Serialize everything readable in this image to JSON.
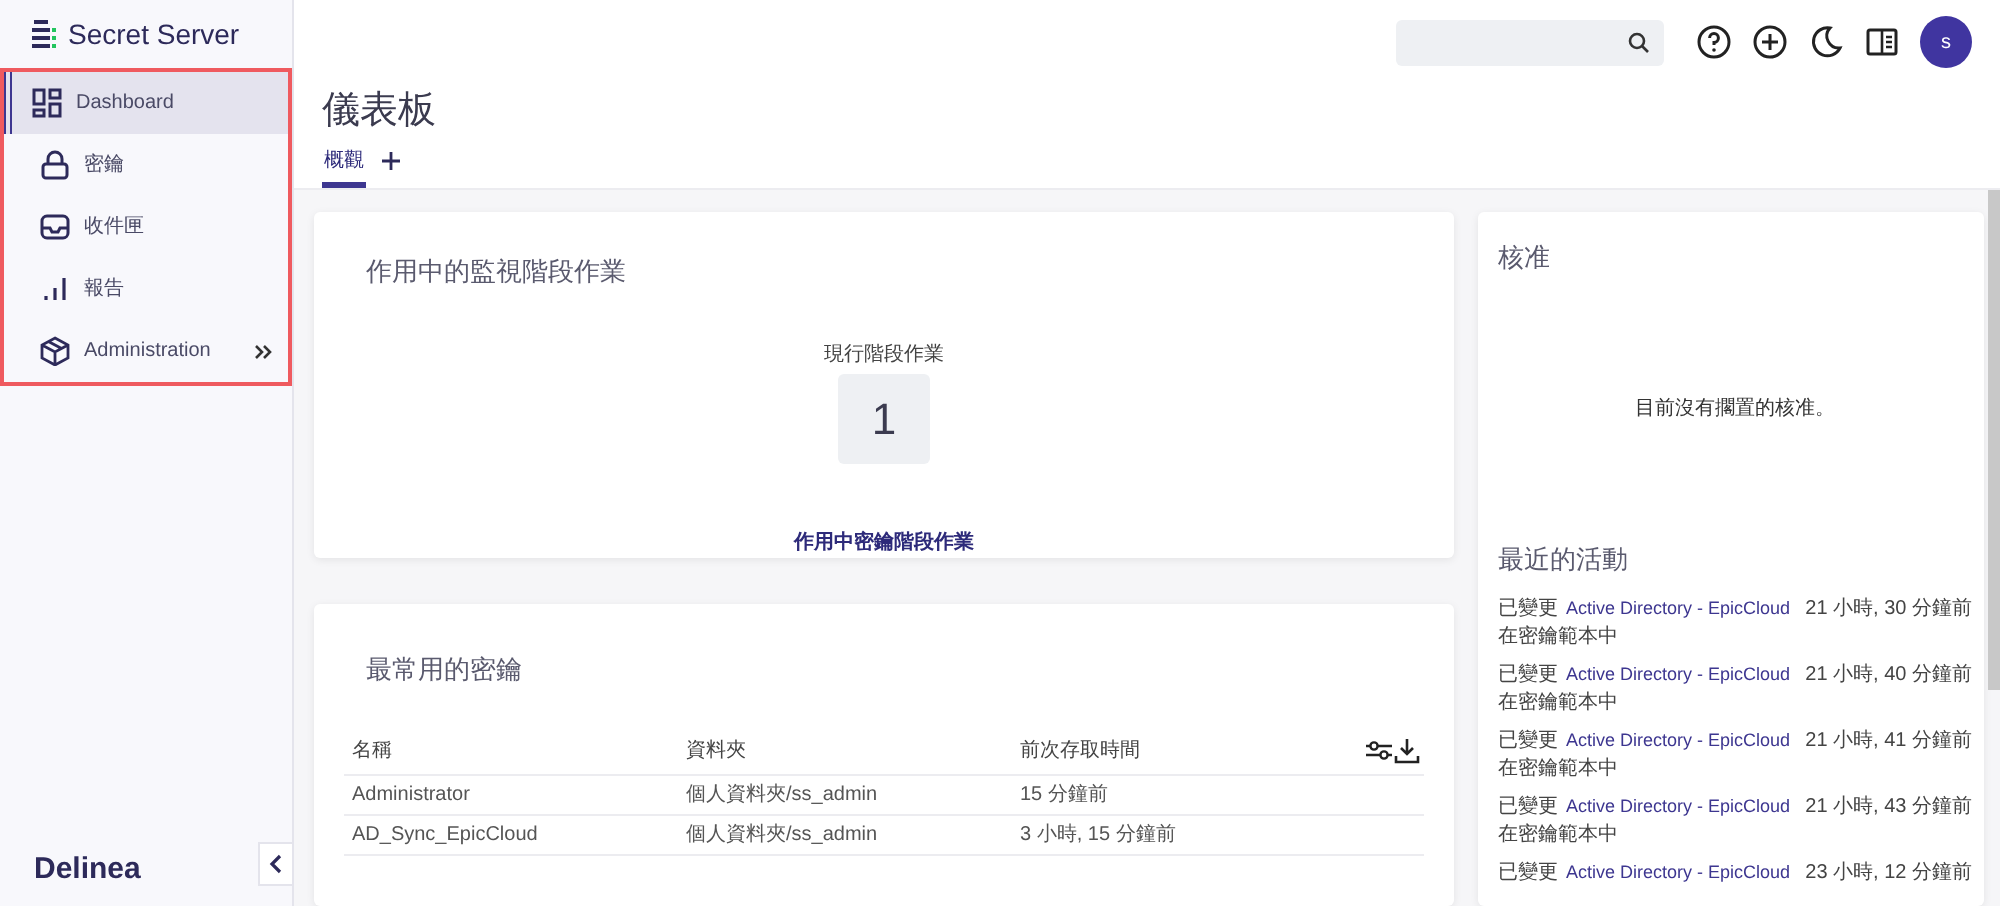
{
  "app": {
    "title": "Secret Server",
    "brand": "Delinea"
  },
  "nav": [
    {
      "label": "Dashboard",
      "selected": true,
      "expandable": false
    },
    {
      "label": "密鑰",
      "selected": false,
      "expandable": false
    },
    {
      "label": "收件匣",
      "selected": false,
      "expandable": false
    },
    {
      "label": "報告",
      "selected": false,
      "expandable": false
    },
    {
      "label": "Administration",
      "selected": false,
      "expandable": true
    }
  ],
  "topbar": {
    "avatar": "s"
  },
  "page": {
    "title": "儀表板",
    "tabs": [
      {
        "label": "概觀",
        "selected": true
      }
    ]
  },
  "sessions_card": {
    "title": "作用中的監視階段作業",
    "stat_label": "現行階段作業",
    "stat_value": "1",
    "link": "作用中密鑰階段作業"
  },
  "secrets_card": {
    "title": "最常用的密鑰",
    "columns": [
      "名稱",
      "資料夾",
      "前次存取時間"
    ],
    "rows": [
      [
        "Administrator",
        "個人資料夾/ss_admin",
        "15 分鐘前"
      ],
      [
        "AD_Sync_EpicCloud",
        "個人資料夾/ss_admin",
        "3 小時, 15 分鐘前"
      ]
    ]
  },
  "approvals": {
    "title": "核准",
    "empty": "目前沒有擱置的核准。"
  },
  "activity": {
    "title": "最近的活動",
    "items": [
      {
        "action": "已變更",
        "target": "Active Directory - EpicCloud",
        "time": "21 小時, 30 分鐘前",
        "detail": "在密鑰範本中"
      },
      {
        "action": "已變更",
        "target": "Active Directory - EpicCloud",
        "time": "21 小時, 40 分鐘前",
        "detail": "在密鑰範本中"
      },
      {
        "action": "已變更",
        "target": "Active Directory - EpicCloud",
        "time": "21 小時, 41 分鐘前",
        "detail": "在密鑰範本中"
      },
      {
        "action": "已變更",
        "target": "Active Directory - EpicCloud",
        "time": "21 小時, 43 分鐘前",
        "detail": "在密鑰範本中"
      },
      {
        "action": "已變更",
        "target": "Active Directory - EpicCloud",
        "time": "23 小時, 12 分鐘前"
      }
    ]
  }
}
